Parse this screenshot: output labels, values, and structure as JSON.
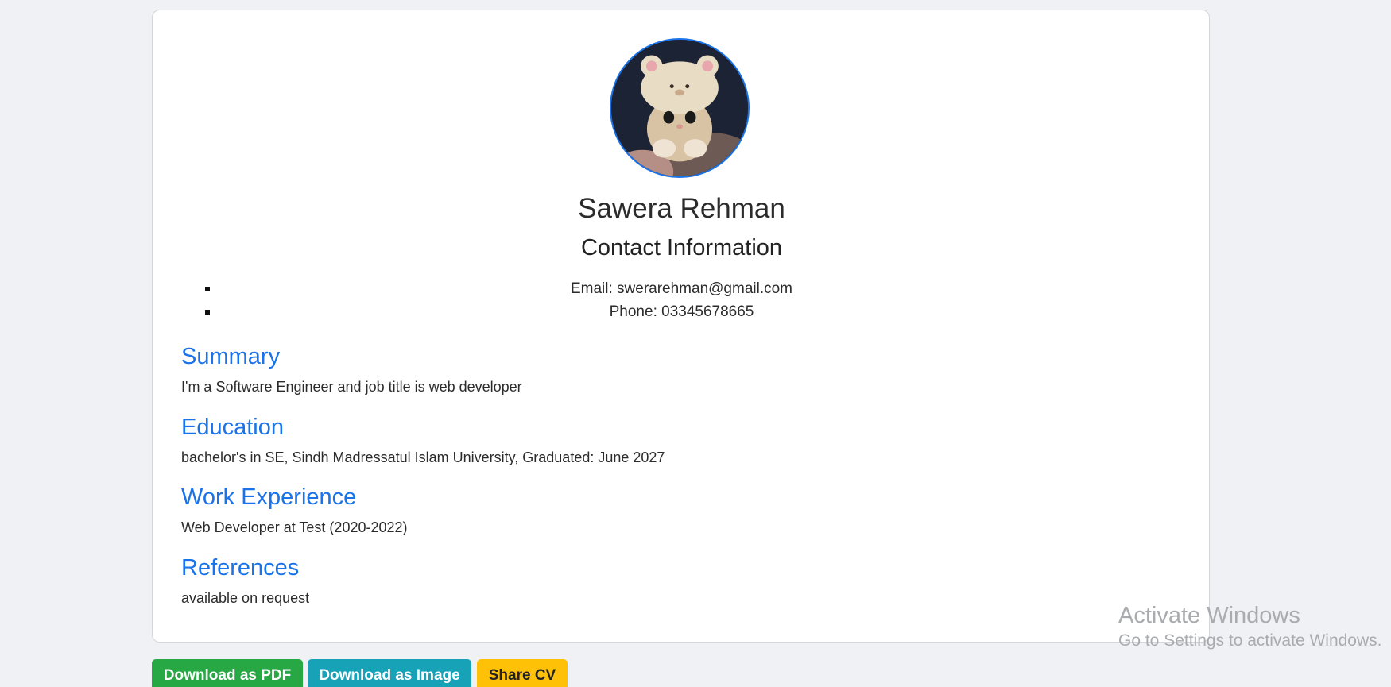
{
  "profile": {
    "name": "Sawera Rehman",
    "avatar_alt": "profile-photo"
  },
  "contact": {
    "title": "Contact Information",
    "items": [
      "Email: swerarehman@gmail.com",
      "Phone: 03345678665"
    ]
  },
  "sections": {
    "summary": {
      "title": "Summary",
      "text": "I'm a Software Engineer and job title is web developer"
    },
    "education": {
      "title": "Education",
      "text": "bachelor's in SE, Sindh Madressatul Islam University, Graduated: June 2027"
    },
    "work": {
      "title": "Work Experience",
      "text": "Web Developer at Test (2020-2022)"
    },
    "references": {
      "title": "References",
      "text": "available on request"
    }
  },
  "actions": {
    "pdf_label": "Download as PDF",
    "image_label": "Download as Image",
    "share_label": "Share CV"
  },
  "watermark": {
    "title": "Activate Windows",
    "subtitle": "Go to Settings to activate Windows."
  },
  "colors": {
    "accent": "#1a73e8",
    "pdf_button": "#28a745",
    "image_button": "#17a2b8",
    "share_button": "#ffc107",
    "background": "#f0f1f5"
  }
}
